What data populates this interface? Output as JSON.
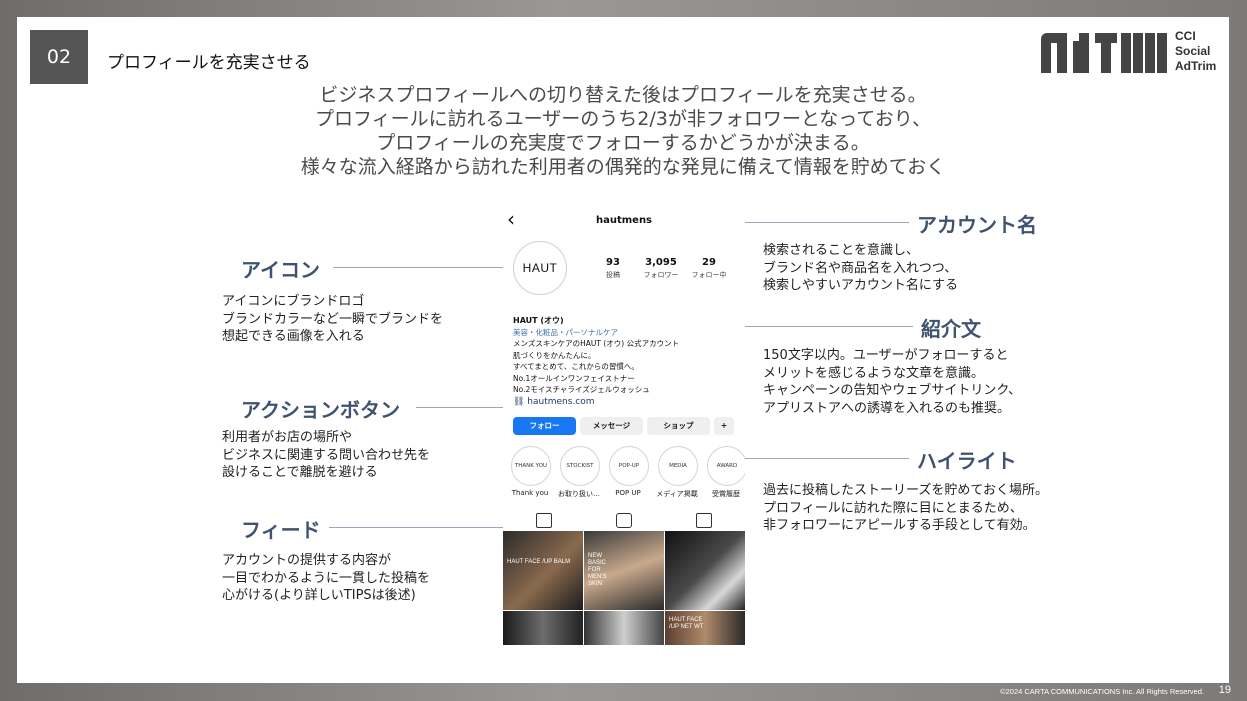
{
  "section": {
    "number": "02",
    "title": "プロフィールを充実させる"
  },
  "logo": {
    "lines": [
      "CCI",
      "Social",
      "AdTrim"
    ]
  },
  "lead": [
    "ビジネスプロフィールへの切り替えた後はプロフィールを充実させる。",
    "プロフィールに訪れるユーザーのうち2/3が非フォロワーとなっており、",
    "プロフィールの充実度でフォローするかどうかが決まる。",
    "様々な流入経路から訪れた利用者の偶発的な発見に備えて情報を貯めておく"
  ],
  "callouts": {
    "icon": {
      "title": "アイコン",
      "desc": [
        "アイコンにブランドロゴ",
        "ブランドカラーなど一瞬でブランドを",
        "想起できる画像を入れる"
      ]
    },
    "action": {
      "title": "アクションボタン",
      "desc": [
        "利用者がお店の場所や",
        "ビジネスに関連する問い合わせ先を",
        "設けることで離脱を避ける"
      ]
    },
    "feed": {
      "title": "フィード",
      "desc": [
        "アカウントの提供する内容が",
        "一目でわかるように一貫した投稿を",
        "心がける(より詳しいTIPSは後述)"
      ]
    },
    "account": {
      "title": "アカウント名",
      "desc": [
        "検索されることを意識し、",
        "ブランド名や商品名を入れつつ、",
        "検索しやすいアカウント名にする"
      ]
    },
    "bio": {
      "title": "紹介文",
      "desc": [
        "150文字以内。ユーザーがフォローすると",
        "メリットを感じるような文章を意識。",
        "キャンペーンの告知やウェブサイトリンク、",
        "アプリストアへの誘導を入れるのも推奨。"
      ]
    },
    "highlight": {
      "title": "ハイライト",
      "desc": [
        "過去に投稿したストーリーズを貯めておく場所。",
        "プロフィールに訪れた際に目にとまるため、",
        "非フォロワーにアピールする手段として有効。"
      ]
    }
  },
  "phone": {
    "username": "hautmens",
    "avatar_text": "HAUT",
    "stats": [
      {
        "num": "93",
        "label": "投稿"
      },
      {
        "num": "3,095",
        "label": "フォロワー"
      },
      {
        "num": "29",
        "label": "フォロー中"
      }
    ],
    "bio": {
      "name": "HAUT (オウ)",
      "category": "美容・化粧品・パーソナルケア",
      "lines": [
        "メンズスキンケアのHAUT (オウ) 公式アカウント",
        "肌づくりをかんたんに。",
        "すべてまとめて、これからの習慣へ。",
        "No.1オールインワンフェイストナー",
        "No.2モイスチャライズジェルウォッシュ"
      ],
      "link": "hautmens.com"
    },
    "buttons": {
      "follow": "フォロー",
      "message": "メッセージ",
      "shop": "ショップ",
      "add": "+"
    },
    "highlights": [
      {
        "circle": "THANK YOU",
        "label": "Thank you"
      },
      {
        "circle": "STOCKIST",
        "label": "お取り扱い…"
      },
      {
        "circle": "POP-UP",
        "label": "POP UP"
      },
      {
        "circle": "MEDIA",
        "label": "メディア掲載"
      },
      {
        "circle": "AWARD",
        "label": "受賞履歴"
      }
    ],
    "posts": [
      {
        "text": "HAUT FACE /UP BALM"
      },
      {
        "text": "NEW BASIC FOR MEN'S SKIN"
      },
      {
        "text": ""
      },
      {
        "text": ""
      },
      {
        "text": ""
      },
      {
        "text": "HAUT FACE /UP NET WT"
      }
    ]
  },
  "footer": {
    "copyright": "©2024 CARTA COMMUNICATIONS Inc.  All Rights Reserved.",
    "page": "19"
  }
}
